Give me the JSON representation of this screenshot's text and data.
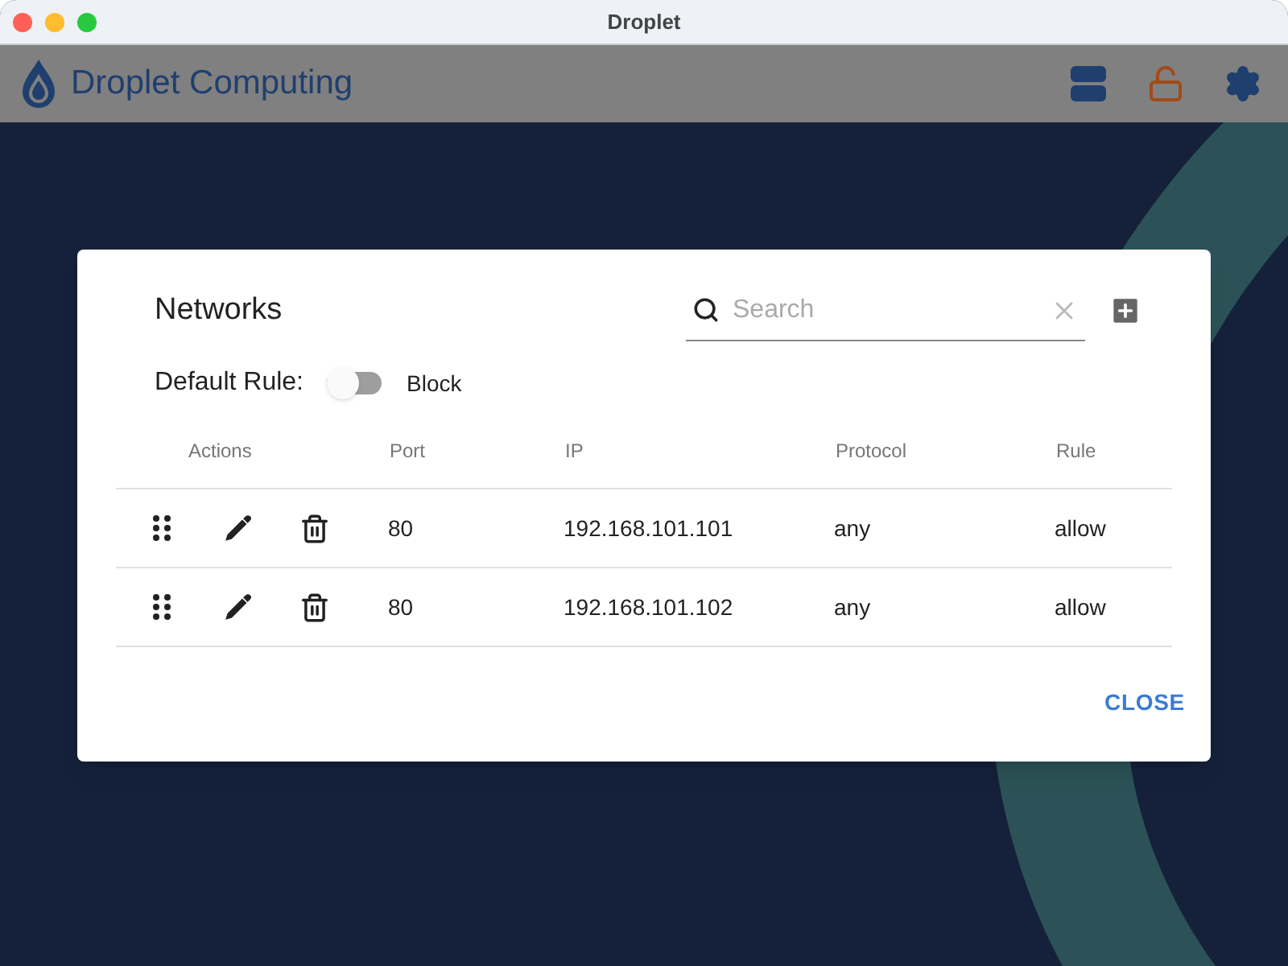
{
  "window": {
    "title": "Droplet"
  },
  "header": {
    "brand": "Droplet Computing"
  },
  "dialog": {
    "title": "Networks",
    "search": {
      "placeholder": "Search"
    },
    "default_rule": {
      "label": "Default Rule:",
      "on": false,
      "value": "Block"
    },
    "columns": [
      "Actions",
      "Port",
      "IP",
      "Protocol",
      "Rule"
    ],
    "rows": [
      {
        "port": "80",
        "ip": "192.168.101.101",
        "protocol": "any",
        "rule": "allow"
      },
      {
        "port": "80",
        "ip": "192.168.101.102",
        "protocol": "any",
        "rule": "allow"
      }
    ],
    "close": "CLOSE"
  }
}
